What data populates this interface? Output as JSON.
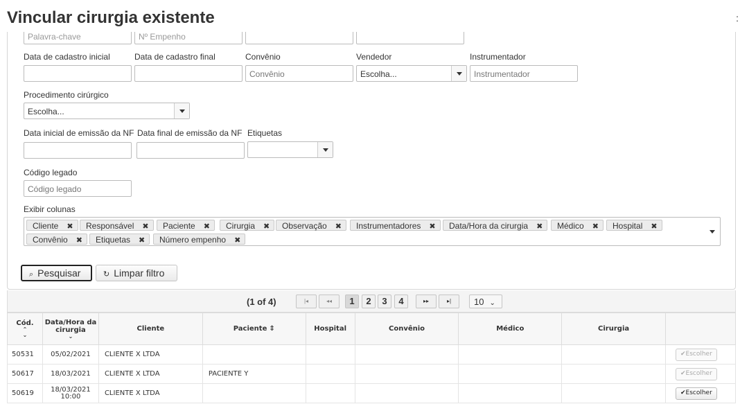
{
  "dialog": {
    "title": "Vincular cirurgia existente",
    "close": ":"
  },
  "top_fields": {
    "palavra_chave": "Palavra-chave",
    "empenho": "Nº Empenho"
  },
  "filters": {
    "data_cadastro_inicial": {
      "label": "Data de cadastro inicial",
      "value": ""
    },
    "data_cadastro_final": {
      "label": "Data de cadastro final",
      "value": ""
    },
    "convenio": {
      "label": "Convênio",
      "placeholder": "Convênio"
    },
    "vendedor": {
      "label": "Vendedor",
      "value": "Escolha..."
    },
    "instrumentador": {
      "label": "Instrumentador",
      "placeholder": "Instrumentador"
    },
    "procedimento": {
      "label": "Procedimento cirúrgico",
      "value": "Escolha..."
    },
    "emissao_inicial": {
      "label": "Data inicial de emissão da NF",
      "value": ""
    },
    "emissao_final": {
      "label": "Data final de emissão da NF",
      "value": ""
    },
    "etiquetas": {
      "label": "Etiquetas",
      "value": ""
    },
    "codigo_legado": {
      "label": "Código legado",
      "placeholder": "Código legado"
    },
    "exibir_colunas": {
      "label": "Exibir colunas",
      "chips": [
        "Cliente",
        "Responsável",
        "Paciente",
        "Cirurgia",
        "Observação",
        "Instrumentadores",
        "Data/Hora da cirurgia",
        "Médico",
        "Hospital",
        "Convênio",
        "Etiquetas",
        "Número empenho"
      ]
    }
  },
  "actions": {
    "pesquisar": "Pesquisar",
    "limpar": "Limpar filtro"
  },
  "paginator": {
    "status": "(1 of 4)",
    "first": "|◂",
    "prev": "◂◂",
    "next": "▸▸",
    "last": "▸|",
    "pages": [
      "1",
      "2",
      "3",
      "4"
    ],
    "current_page": "1",
    "rows_per_page": "10"
  },
  "table": {
    "headers": {
      "cod": "Cód.",
      "data_hora": "Data/Hora da cirurgia",
      "cliente": "Cliente",
      "paciente": "Paciente",
      "hospital": "Hospital",
      "convenio": "Convênio",
      "medico": "Médico",
      "cirurgia": "Cirurgia"
    },
    "rows": [
      {
        "cod": "50531",
        "data": "05/02/2021",
        "hora": "",
        "cliente": "CLIENTE X LTDA",
        "paciente": "",
        "action": "Escolher",
        "enabled": false
      },
      {
        "cod": "50617",
        "data": "18/03/2021",
        "hora": "",
        "cliente": "CLIENTE X LTDA",
        "paciente": "PACIENTE Y",
        "action": "Escolher",
        "enabled": false
      },
      {
        "cod": "50619",
        "data": "18/03/2021",
        "hora": "10:00",
        "cliente": "CLIENTE X LTDA",
        "paciente": "",
        "action": "Escolher",
        "enabled": true
      }
    ]
  }
}
